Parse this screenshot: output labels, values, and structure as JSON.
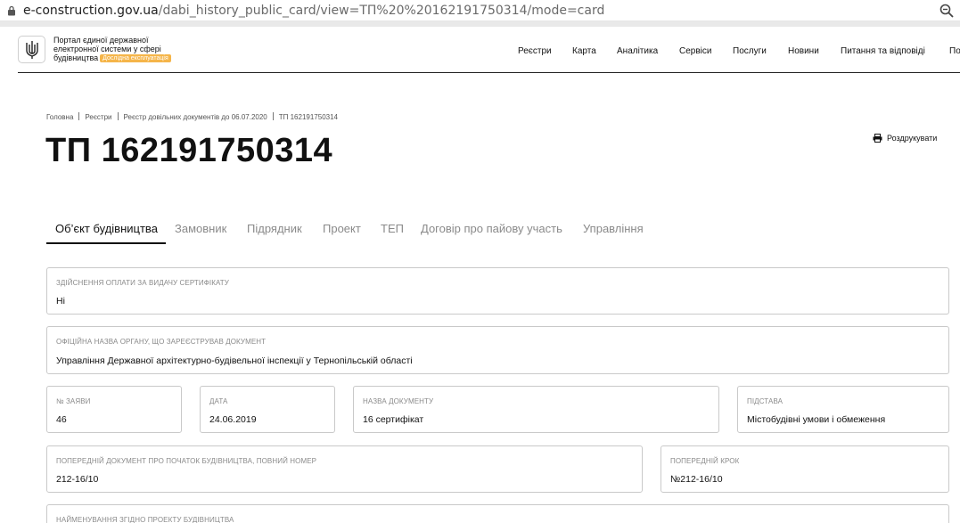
{
  "browser": {
    "url_host": "e-construction.gov.ua",
    "url_path": "/dabi_history_public_card/view=ТП%20%20162191750314/mode=card"
  },
  "header": {
    "brand_line1": "Портал єдиної державної",
    "brand_line2": "електронної системи у сфері",
    "brand_line3": "будівництва",
    "badge": "Дослідна експлуатація",
    "nav": [
      "Реєстри",
      "Карта",
      "Аналітика",
      "Сервіси",
      "Послуги",
      "Новини",
      "Питання та відповіді",
      "По"
    ]
  },
  "breadcrumb": [
    "Головна",
    "Реєстри",
    "Реєстр довільних документів до 06.07.2020",
    "ТП 162191750314"
  ],
  "page": {
    "title": "ТП 162191750314",
    "print_label": "Роздрукувати"
  },
  "tabs": [
    {
      "label": "Об’єкт будівництва",
      "active": true
    },
    {
      "label": "Замовник",
      "active": false
    },
    {
      "label": "Підрядник",
      "active": false
    },
    {
      "label": "Проект",
      "active": false
    },
    {
      "label": "ТЕП",
      "active": false
    },
    {
      "label": "Договір про пайову участь",
      "active": false
    },
    {
      "label": "Управління",
      "active": false
    }
  ],
  "fields": {
    "payment": {
      "label": "Здійснення оплати за видачу сертифікату",
      "value": "Ні"
    },
    "authority": {
      "label": "Офіційна назва органу, що зареєстрував документ",
      "value": "Управління Державної архітектурно-будівельної інспекції у Тернопільській області"
    },
    "app_number": {
      "label": "№ заяви",
      "value": "46"
    },
    "date": {
      "label": "Дата",
      "value": "24.06.2019"
    },
    "doc_name": {
      "label": "Назва документу",
      "value": "16 сертифікат"
    },
    "basis": {
      "label": "Підстава",
      "value": "Містобудівні умови і обмеження"
    },
    "prev_doc": {
      "label": "Попередній документ про початок будівництва, повний номер",
      "value": "212-16/10"
    },
    "prev_step": {
      "label": "Попередній крок",
      "value": "№212-16/10"
    },
    "project_name": {
      "label": "Найменування згідно проекту будівництва",
      "value": ""
    }
  }
}
